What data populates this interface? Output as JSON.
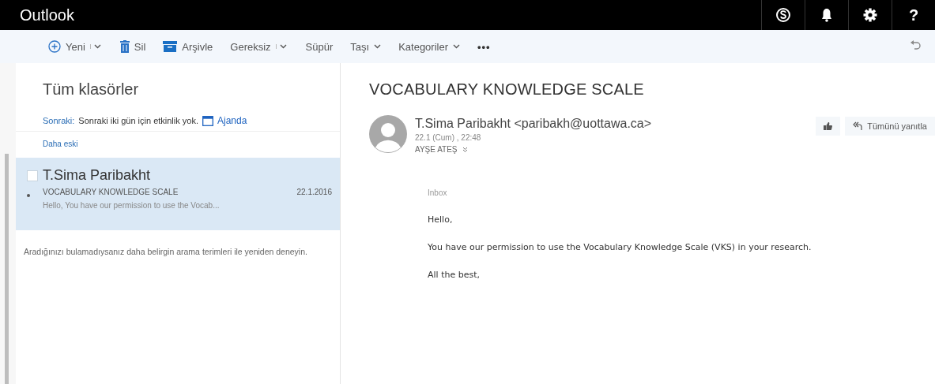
{
  "header": {
    "title": "Outlook",
    "help": "?"
  },
  "toolbar": {
    "items": [
      {
        "kind": "new",
        "label": "Yeni"
      },
      {
        "kind": "delete",
        "label": "Sil"
      },
      {
        "kind": "archive",
        "label": "Arşivle"
      },
      {
        "kind": "junk",
        "label": "Gereksiz"
      },
      {
        "kind": "sweep",
        "label": "Süpür"
      },
      {
        "kind": "move",
        "label": "Taşı"
      },
      {
        "kind": "categories",
        "label": "Kategoriler"
      },
      {
        "kind": "more",
        "label": "•••"
      }
    ]
  },
  "folder_pane": {
    "title": "Tüm klasörler",
    "agenda": {
      "label": "Sonraki:",
      "text": "Sonraki iki gün için etkinlik yok.",
      "link": "Ajanda"
    },
    "group": "Daha eski",
    "messages": [
      {
        "sender": "T.Sima Paribakht",
        "subject": "VOCABULARY KNOWLEDGE SCALE",
        "date": "22.1.2016",
        "preview": "Hello,  You have our permission to use the Vocab...",
        "selected": true,
        "checked": false
      }
    ],
    "hint": "Aradığınızı bulamadıysanız daha belirgin arama terimleri ile yeniden deneyin."
  },
  "reading_pane": {
    "subject": "VOCABULARY KNOWLEDGE SCALE",
    "from": "T.Sima Paribakht <paribakh@uottawa.ca>",
    "date": "22.1 (Cum) , 22:48",
    "to": "AYŞE ATEŞ",
    "reply_all": "Tümünü yanıtla",
    "folder": "Inbox",
    "body": [
      "Hello,",
      "You have our permission to use the Vocabulary Knowledge Scale  (VKS) in your research.",
      "All the best,"
    ]
  }
}
